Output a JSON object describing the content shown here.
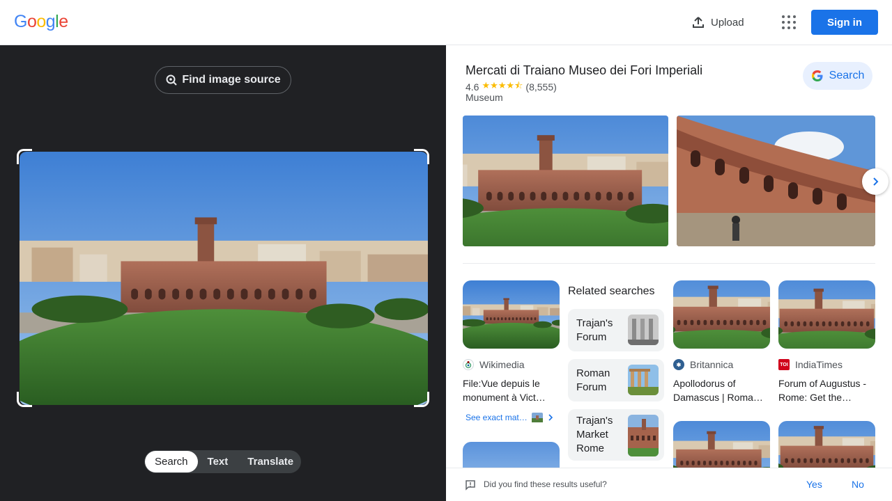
{
  "header": {
    "logo": [
      "G",
      "o",
      "o",
      "g",
      "l",
      "e"
    ],
    "logo_colors": [
      "#4285F4",
      "#EA4335",
      "#FBBC05",
      "#4285F4",
      "#34A853",
      "#EA4335"
    ],
    "upload_label": "Upload",
    "signin_label": "Sign in"
  },
  "left": {
    "find_source_label": "Find image source",
    "modes": [
      "Search",
      "Text",
      "Translate"
    ],
    "active_mode": "Search"
  },
  "knowledge_panel": {
    "title": "Mercati di Traiano Museo dei Fori Imperiali",
    "rating": "4.6",
    "stars": "★★★★⯪",
    "reviews": "(8,555)",
    "category": "Museum",
    "search_label": "Search"
  },
  "results": [
    {
      "source": "Wikimedia",
      "title": "File:Vue depuis le monument à Vict…",
      "favicon_color": "#ffffff"
    },
    {
      "source": "Britannica",
      "title": "Apollodorus of Damascus | Roma…",
      "favicon_color": "#2f5f91"
    },
    {
      "source": "IndiaTimes",
      "title": "Forum of Augustus - Rome: Get the…",
      "favicon_color": "#d0021b"
    }
  ],
  "exact_matches_label": "See exact mat…",
  "related": {
    "heading": "Related searches",
    "items": [
      {
        "label": "Trajan's Forum"
      },
      {
        "label": "Roman Forum"
      },
      {
        "label": "Trajan's Market Rome"
      }
    ]
  },
  "feedback": {
    "question": "Did you find these results useful?",
    "yes": "Yes",
    "no": "No"
  },
  "colors": {
    "accent": "#1a73e8",
    "dark_bg": "#202124",
    "star": "#fbbc04"
  }
}
